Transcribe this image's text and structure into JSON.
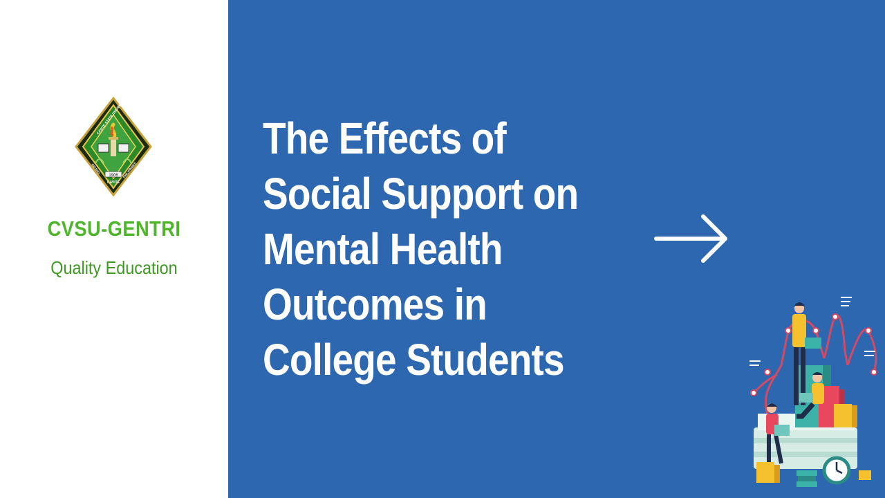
{
  "brand": {
    "name": "CVSU-GENTRI",
    "tagline": "Quality Education",
    "logo_text": [
      "CAVITE STATE UNIVERSITY",
      "INDANG",
      "PHILIPPINES",
      "CAVITE",
      "1906"
    ]
  },
  "slide": {
    "title_lines": [
      "The Effects of",
      "Social Support on",
      "Mental Health",
      "Outcomes in",
      "College Students"
    ]
  },
  "colors": {
    "background_left": "#ffffff",
    "background_right": "#2c67b0",
    "brand_green": "#4fb52a",
    "title_text": "#ffffff"
  },
  "icons": {
    "logo": "cvsu-seal-icon",
    "arrow": "right-arrow-icon",
    "illustration": "students-with-laptops-and-charts-illustration"
  }
}
